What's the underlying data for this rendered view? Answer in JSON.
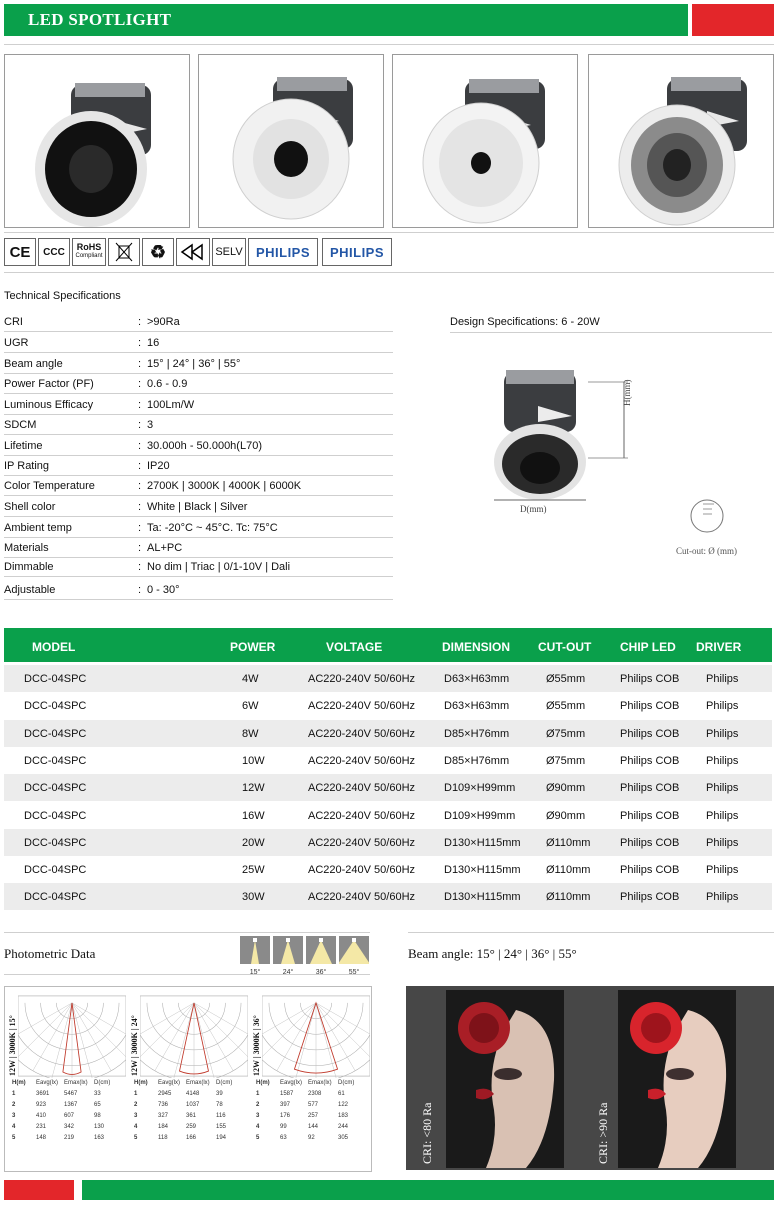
{
  "header": {
    "title": "LED SPOTLIGHT"
  },
  "certs": [
    "CE",
    "CCC",
    "RoHS Compliant",
    "WEEE",
    "Recycle",
    "EMC",
    "SELV",
    "PHILIPS",
    "PHILIPS"
  ],
  "cert_labels": {
    "rohs_top": "RoHS",
    "rohs_bottom": "Compliant",
    "selv": "SELV",
    "philips": "PHILIPS"
  },
  "specs": {
    "title": "Technical Specifications",
    "rows": [
      {
        "k": "CRI",
        "v": ">90Ra"
      },
      {
        "k": "UGR",
        "v": "16"
      },
      {
        "k": "Beam angle",
        "v": "15° | 24° | 36° | 55°"
      },
      {
        "k": "Power Factor (PF)",
        "v": "0.6 - 0.9"
      },
      {
        "k": "Luminous Efficacy",
        "v": "100Lm/W"
      },
      {
        "k": "SDCM",
        "v": "3"
      },
      {
        "k": "Lifetime",
        "v": "30.000h - 50.000h(L70)"
      },
      {
        "k": "IP Rating",
        "v": "IP20"
      },
      {
        "k": "Color Temperature",
        "v": "2700K | 3000K | 4000K | 6000K"
      },
      {
        "k": "Shell color",
        "v": "White | Black | Silver"
      },
      {
        "k": "Ambient temp",
        "v": "Ta: -20°C ~ 45°C. Tc: 75°C"
      },
      {
        "k": "Materials",
        "v": "AL+PC"
      },
      {
        "k": "Dimmable",
        "v": "No dim | Triac | 0/1-10V | Dali"
      },
      {
        "k": "Adjustable",
        "v": "0 - 30°"
      }
    ]
  },
  "design": {
    "title": "Design Specifications: 6 - 20W",
    "h_label": "H(mm)",
    "d_label": "D(mm)",
    "cutout_label": "Cut-out: Ø (mm)"
  },
  "table": {
    "headers": [
      "MODEL",
      "POWER",
      "VOLTAGE",
      "DIMENSION",
      "CUT-OUT",
      "CHIP LED",
      "DRIVER"
    ],
    "rows": [
      [
        "DCC-04SPC",
        "4W",
        "AC220-240V 50/60Hz",
        "D63×H63mm",
        "Ø55mm",
        "Philips COB",
        "Philips"
      ],
      [
        "DCC-04SPC",
        "6W",
        "AC220-240V 50/60Hz",
        "D63×H63mm",
        "Ø55mm",
        "Philips COB",
        "Philips"
      ],
      [
        "DCC-04SPC",
        "8W",
        "AC220-240V 50/60Hz",
        "D85×H76mm",
        "Ø75mm",
        "Philips COB",
        "Philips"
      ],
      [
        "DCC-04SPC",
        "10W",
        "AC220-240V 50/60Hz",
        "D85×H76mm",
        "Ø75mm",
        "Philips COB",
        "Philips"
      ],
      [
        "DCC-04SPC",
        "12W",
        "AC220-240V 50/60Hz",
        "D109×H99mm",
        "Ø90mm",
        "Philips COB",
        "Philips"
      ],
      [
        "DCC-04SPC",
        "16W",
        "AC220-240V 50/60Hz",
        "D109×H99mm",
        "Ø90mm",
        "Philips COB",
        "Philips"
      ],
      [
        "DCC-04SPC",
        "20W",
        "AC220-240V 50/60Hz",
        "D130×H115mm",
        "Ø110mm",
        "Philips COB",
        "Philips"
      ],
      [
        "DCC-04SPC",
        "25W",
        "AC220-240V 50/60Hz",
        "D130×H115mm",
        "Ø110mm",
        "Philips COB",
        "Philips"
      ],
      [
        "DCC-04SPC",
        "30W",
        "AC220-240V 50/60Hz",
        "D130×H115mm",
        "Ø110mm",
        "Philips COB",
        "Philips"
      ]
    ]
  },
  "photometric": {
    "title": "Photometric Data",
    "beam_icons": [
      "15°",
      "24°",
      "36°",
      "55°"
    ],
    "charts": [
      {
        "label": "12W | 3000K | 15°",
        "headers": [
          "H(m)",
          "Eavg(lx)",
          "Emax(lx)",
          "D(cm)"
        ],
        "rows": [
          [
            "1",
            "3691",
            "5467",
            "33"
          ],
          [
            "2",
            "923",
            "1367",
            "65"
          ],
          [
            "3",
            "410",
            "607",
            "98"
          ],
          [
            "4",
            "231",
            "342",
            "130"
          ],
          [
            "5",
            "148",
            "219",
            "163"
          ]
        ]
      },
      {
        "label": "12W | 3000K | 24°",
        "headers": [
          "H(m)",
          "Eavg(lx)",
          "Emax(lx)",
          "D(cm)"
        ],
        "rows": [
          [
            "1",
            "2945",
            "4148",
            "39"
          ],
          [
            "2",
            "736",
            "1037",
            "78"
          ],
          [
            "3",
            "327",
            "361",
            "116"
          ],
          [
            "4",
            "184",
            "259",
            "155"
          ],
          [
            "5",
            "118",
            "166",
            "194"
          ]
        ]
      },
      {
        "label": "12W | 3000K | 36°",
        "headers": [
          "H(m)",
          "Eavg(lx)",
          "Emax(lx)",
          "D(cm)"
        ],
        "rows": [
          [
            "1",
            "1587",
            "2308",
            "61"
          ],
          [
            "2",
            "397",
            "577",
            "122"
          ],
          [
            "3",
            "176",
            "257",
            "183"
          ],
          [
            "4",
            "99",
            "144",
            "244"
          ],
          [
            "5",
            "63",
            "92",
            "305"
          ]
        ]
      }
    ]
  },
  "beam": {
    "title": "Beam angle: 15° | 24° | 36° | 55°",
    "left_label": "CRI: <80 Ra",
    "right_label": "CRI: >90 Ra"
  },
  "colors": {
    "green": "#0aa04b",
    "red": "#e3262a"
  }
}
